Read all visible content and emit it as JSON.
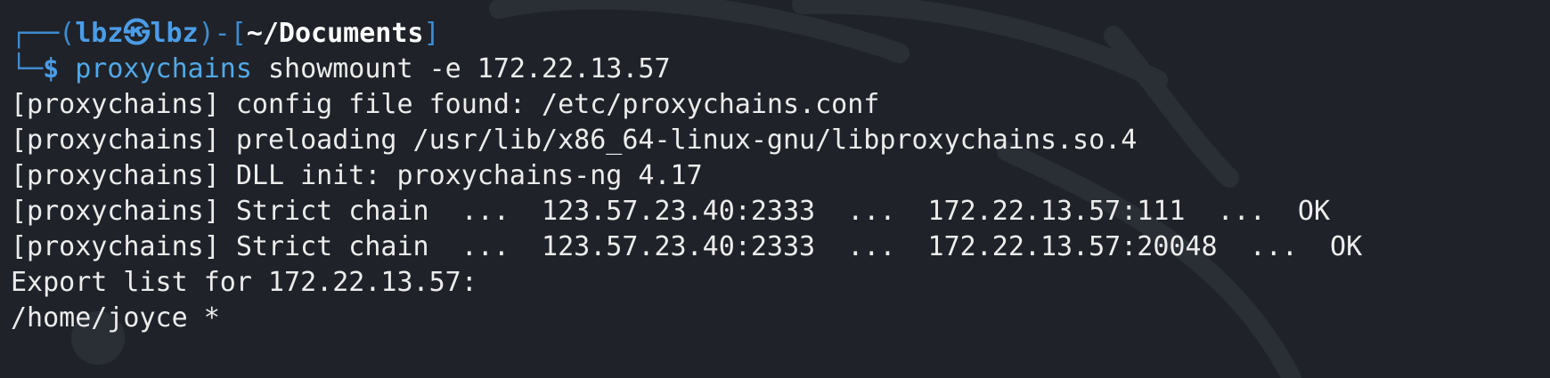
{
  "prompt": {
    "frame_top_left": "┌──(",
    "user": "lbz",
    "separator_icon": "skull-icon",
    "separator_glyph": "㉿",
    "host": "lbz",
    "frame_mid": ")-[",
    "cwd": "~/Documents",
    "frame_end": "]",
    "frame_bottom_left": "└─",
    "dollar": "$",
    "command": "proxychains",
    "args_before_flag": " showmount ",
    "flag": "-e",
    "args_after_flag": " 172.22.13.57"
  },
  "output_lines": [
    "[proxychains] config file found: /etc/proxychains.conf",
    "[proxychains] preloading /usr/lib/x86_64-linux-gnu/libproxychains.so.4",
    "[proxychains] DLL init: proxychains-ng 4.17",
    "[proxychains] Strict chain  ...  123.57.23.40:2333  ...  172.22.13.57:111  ...  OK",
    "[proxychains] Strict chain  ...  123.57.23.40:2333  ...  172.22.13.57:20048  ...  OK",
    "Export list for 172.22.13.57:",
    "/home/joyce *"
  ],
  "colors": {
    "background": "#1f2329",
    "frame": "#3e8bd0",
    "user": "#4c9ce6",
    "command": "#51a8e8",
    "text": "#ececec"
  }
}
